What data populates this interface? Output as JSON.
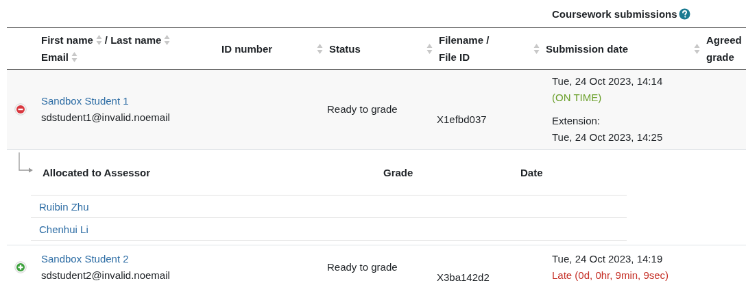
{
  "caption": {
    "text": "Coursework submissions",
    "help": true
  },
  "columns": [
    {
      "kind": "multi",
      "lines": [
        [
          {
            "label": "First name",
            "sortable": true
          },
          {
            "label": "/ Last name",
            "sortable": true
          }
        ],
        [
          {
            "label": "Email",
            "sortable": true
          }
        ]
      ]
    },
    {
      "kind": "single",
      "lines": [
        "ID number"
      ],
      "sortable": true
    },
    {
      "kind": "single",
      "lines": [
        "Status"
      ],
      "sortable": true
    },
    {
      "kind": "single",
      "lines": [
        "Filename /",
        "File ID"
      ],
      "sortable": true
    },
    {
      "kind": "single",
      "lines": [
        "Submission date"
      ],
      "sortable": true
    },
    {
      "kind": "single",
      "lines": [
        "Agreed",
        "grade"
      ]
    }
  ],
  "rows": [
    {
      "expanded": true,
      "name": "Sandbox Student 1",
      "email": "sdstudent1@invalid.noemail",
      "status": "Ready to grade",
      "file_id": "X1efbd037",
      "submission": {
        "date": "Tue, 24 Oct 2023, 14:14",
        "timeliness": "(ON TIME)",
        "late": false
      },
      "extension": {
        "label": "Extension:",
        "date": "Tue, 24 Oct 2023, 14:25"
      },
      "allocations": {
        "columns": [
          "Allocated to Assessor",
          "Grade",
          "Date"
        ],
        "assessors": [
          "Ruibin Zhu",
          "Chenhui Li"
        ]
      }
    },
    {
      "expanded": false,
      "name": "Sandbox Student 2",
      "email": "sdstudent2@invalid.noemail",
      "status": "Ready to grade",
      "file_id": "X3ba142d2",
      "submission": {
        "date": "Tue, 24 Oct 2023, 14:19",
        "timeliness": "Late (0d, 0hr, 9min, 9sec)",
        "late": true
      }
    }
  ]
}
